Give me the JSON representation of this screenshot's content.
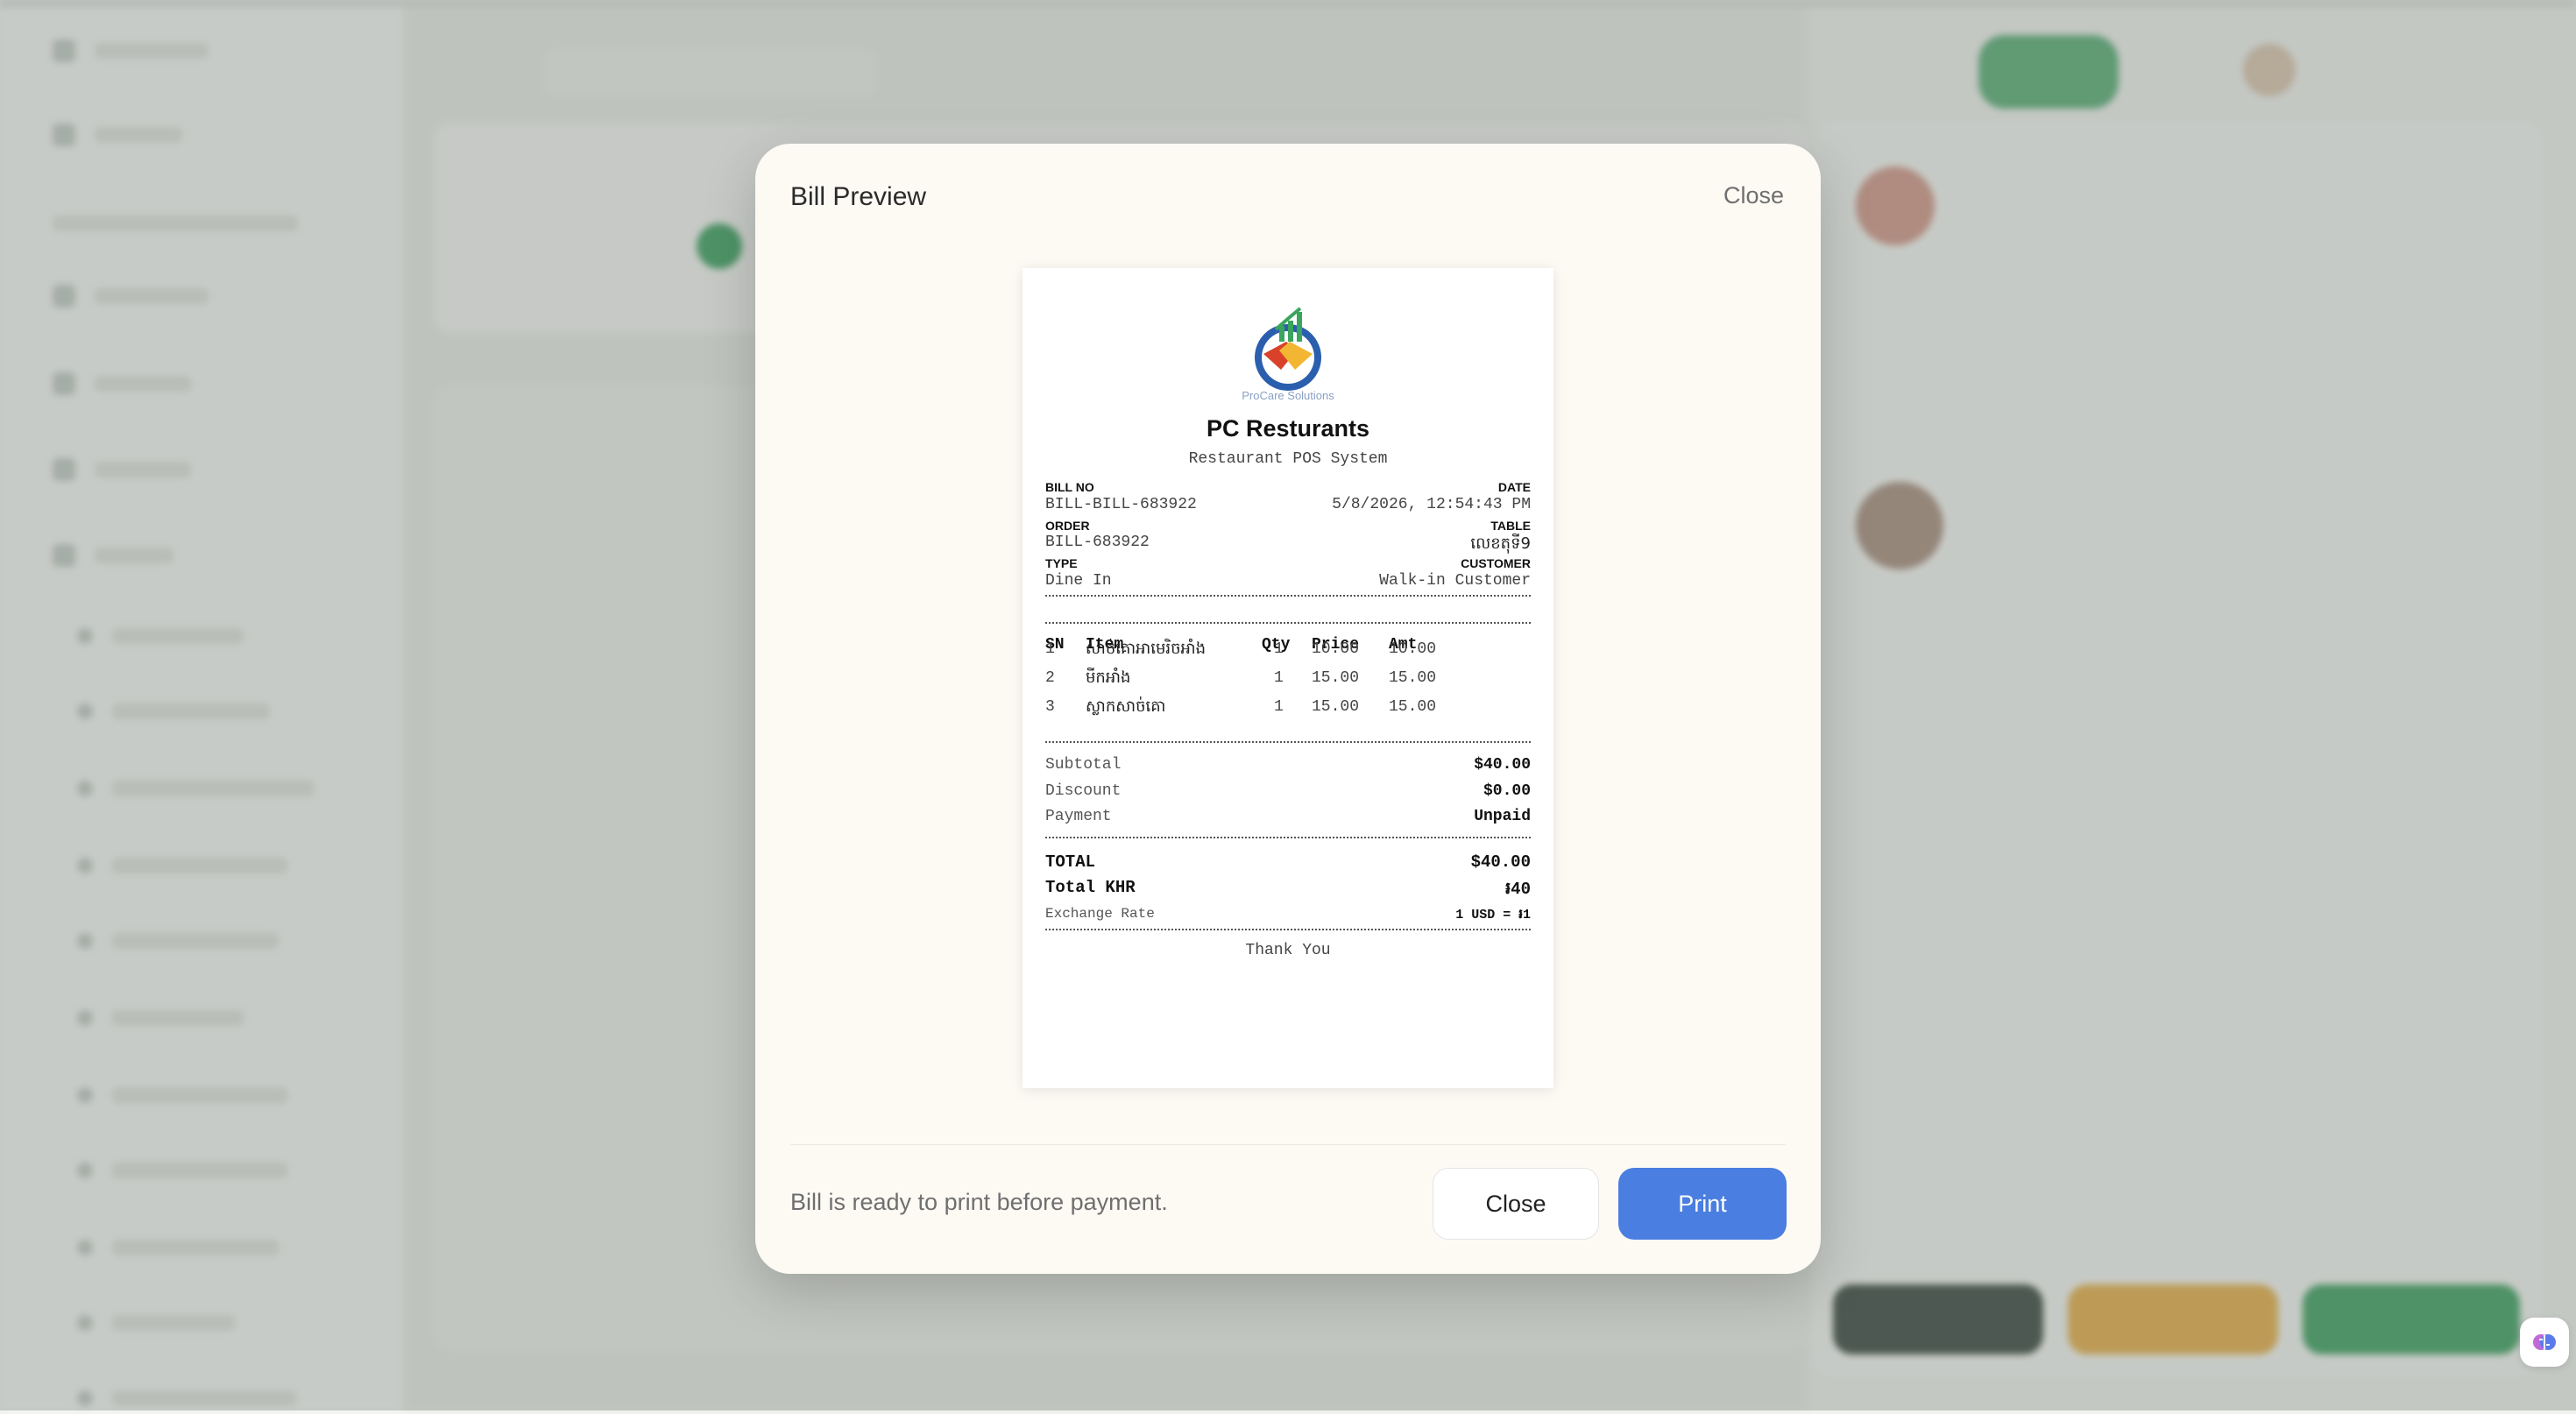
{
  "modal": {
    "title": "Bill Preview",
    "close_top_label": "Close",
    "footer_message": "Bill is ready to print before payment.",
    "close_button_label": "Close",
    "print_button_label": "Print"
  },
  "receipt": {
    "logo_text": "ProCare Solutions",
    "restaurant_name": "PC Resturants",
    "subtitle": "Restaurant POS System",
    "bill_no_label": "BILL NO",
    "bill_no": "BILL-BILL-683922",
    "date_label": "DATE",
    "date": "5/8/2026, 12:54:43 PM",
    "order_label": "ORDER",
    "order": "BILL-683922",
    "table_label": "TABLE",
    "table": "លេខតុទី9",
    "type_label": "TYPE",
    "type": "Dine In",
    "customer_label": "CUSTOMER",
    "customer": "Walk-in Customer",
    "columns": [
      "SN",
      "Item",
      "Qty",
      "Price",
      "Amt"
    ],
    "items": [
      {
        "sn": "1",
        "name": "សាច់គោអាមេរិចអាំង",
        "qty": "1",
        "price": "10.00",
        "amt": "10.00"
      },
      {
        "sn": "2",
        "name": "មីកអាំង",
        "qty": "1",
        "price": "15.00",
        "amt": "15.00"
      },
      {
        "sn": "3",
        "name": "ស្លាកសាច់គោ",
        "qty": "1",
        "price": "15.00",
        "amt": "15.00"
      }
    ],
    "subtotal_label": "Subtotal",
    "subtotal": "$40.00",
    "discount_label": "Discount",
    "discount": "$0.00",
    "payment_label": "Payment",
    "payment": "Unpaid",
    "total_label": "TOTAL",
    "total": "$40.00",
    "total_khr_label": "Total KHR",
    "total_khr": "៛40",
    "exchange_label": "Exchange Rate",
    "exchange": "1 USD = ៛1",
    "thank_you": "Thank You"
  },
  "colors": {
    "print_button": "#4a7ee0",
    "modal_bg": "#fdfaf4",
    "logo_red": "#d9412b",
    "logo_blue": "#2b5fae",
    "logo_yellow": "#f2b632",
    "logo_green": "#3aa55c"
  }
}
